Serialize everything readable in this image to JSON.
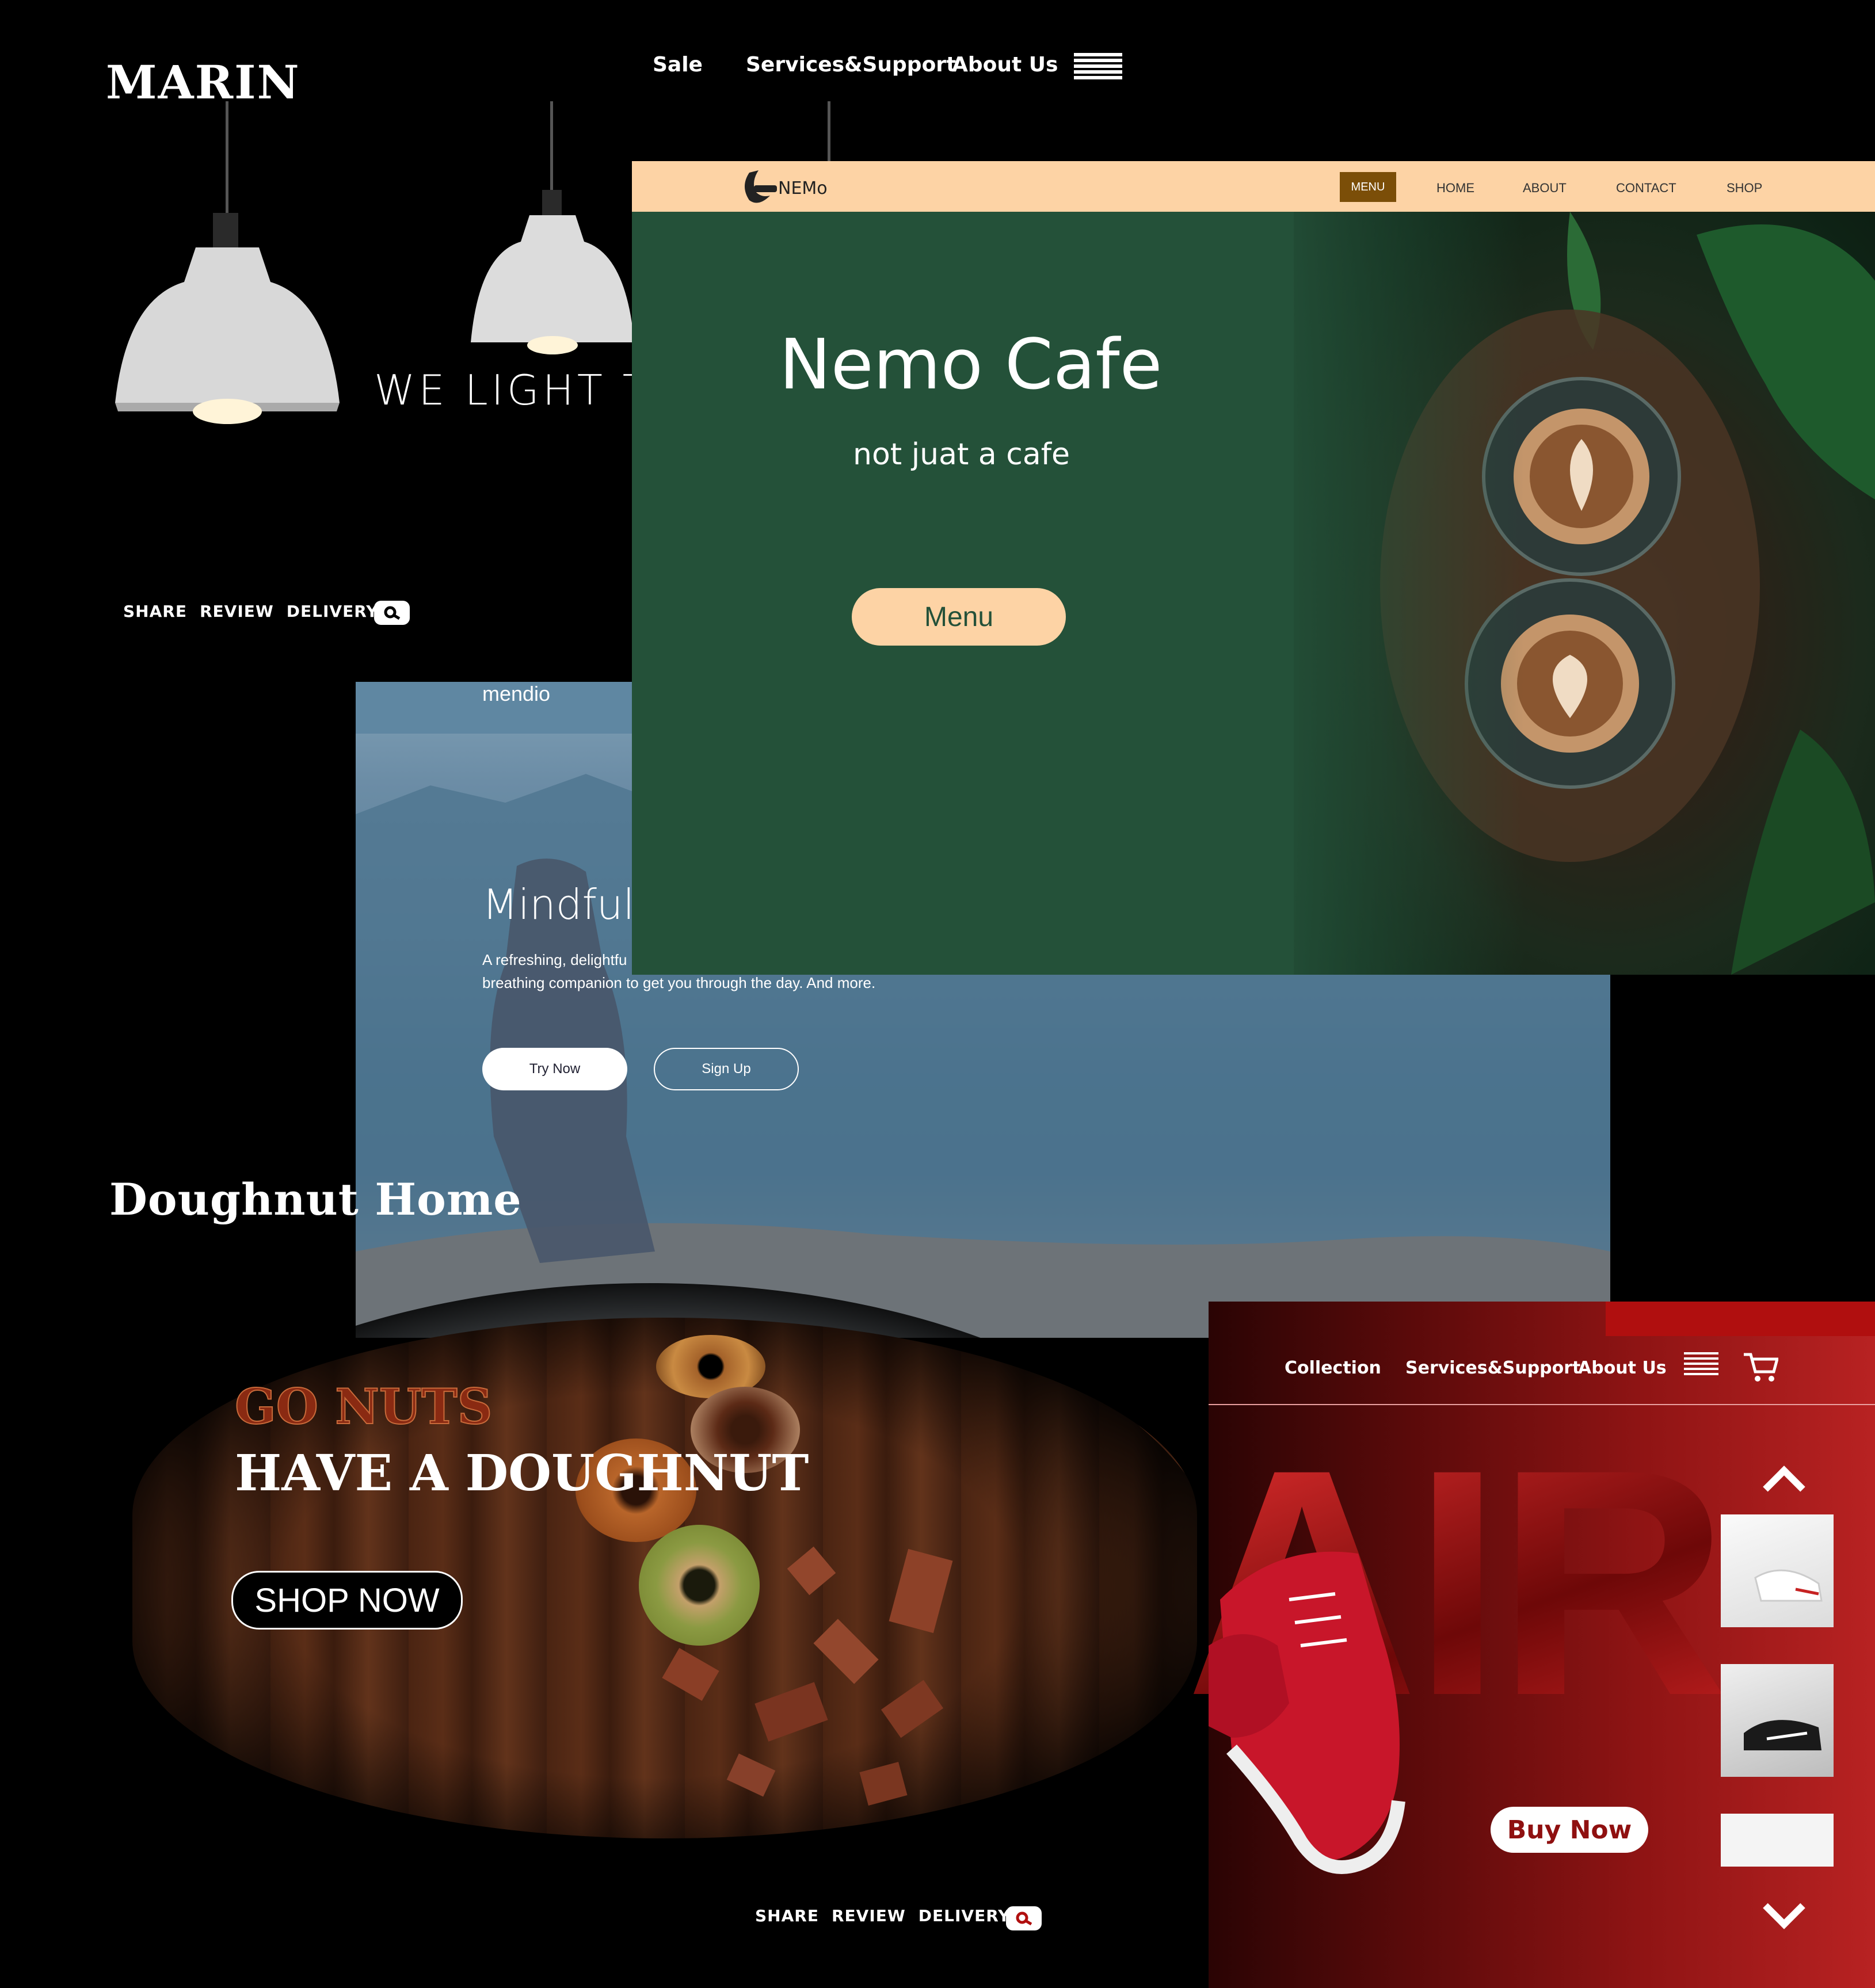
{
  "marin": {
    "logo": "MARIN",
    "nav": [
      "Sale",
      "Services&Support",
      "About Us"
    ],
    "hero_text": "WE LIGHT TH",
    "footer_links": [
      "SHARE",
      "REVIEW",
      "DELIVERY"
    ]
  },
  "nemo": {
    "logo": "NEMo",
    "nav": {
      "menu": "MENU",
      "home": "HOME",
      "about": "ABOUT",
      "contact": "CONTACT",
      "shop": "SHOP"
    },
    "title": "Nemo Cafe",
    "subtitle": "not juat a cafe",
    "button": "Menu",
    "colors": {
      "background": "#245139",
      "bar": "#fdd3a5",
      "active": "#7b4e08"
    }
  },
  "mendio": {
    "brand": "mendio",
    "heading": "Mindful",
    "desc_line1": "A refreshing, delightfu",
    "desc_line2": "breathing companion to get you through the day. And more.",
    "try_button": "Try Now",
    "signup_button": "Sign Up"
  },
  "doughnut": {
    "title": "Doughnut Home",
    "tagline": "GO NUTS",
    "headline": "HAVE A DOUGHNUT",
    "button": "SHOP NOW",
    "footer_links": [
      "SHARE",
      "REVIEW",
      "DELIVERY"
    ]
  },
  "air": {
    "nav": [
      "Collection",
      "Services&Support",
      "About Us"
    ],
    "big_text": "AIR",
    "button": "Buy Now",
    "colors": {
      "accent": "#b00f0f"
    }
  }
}
